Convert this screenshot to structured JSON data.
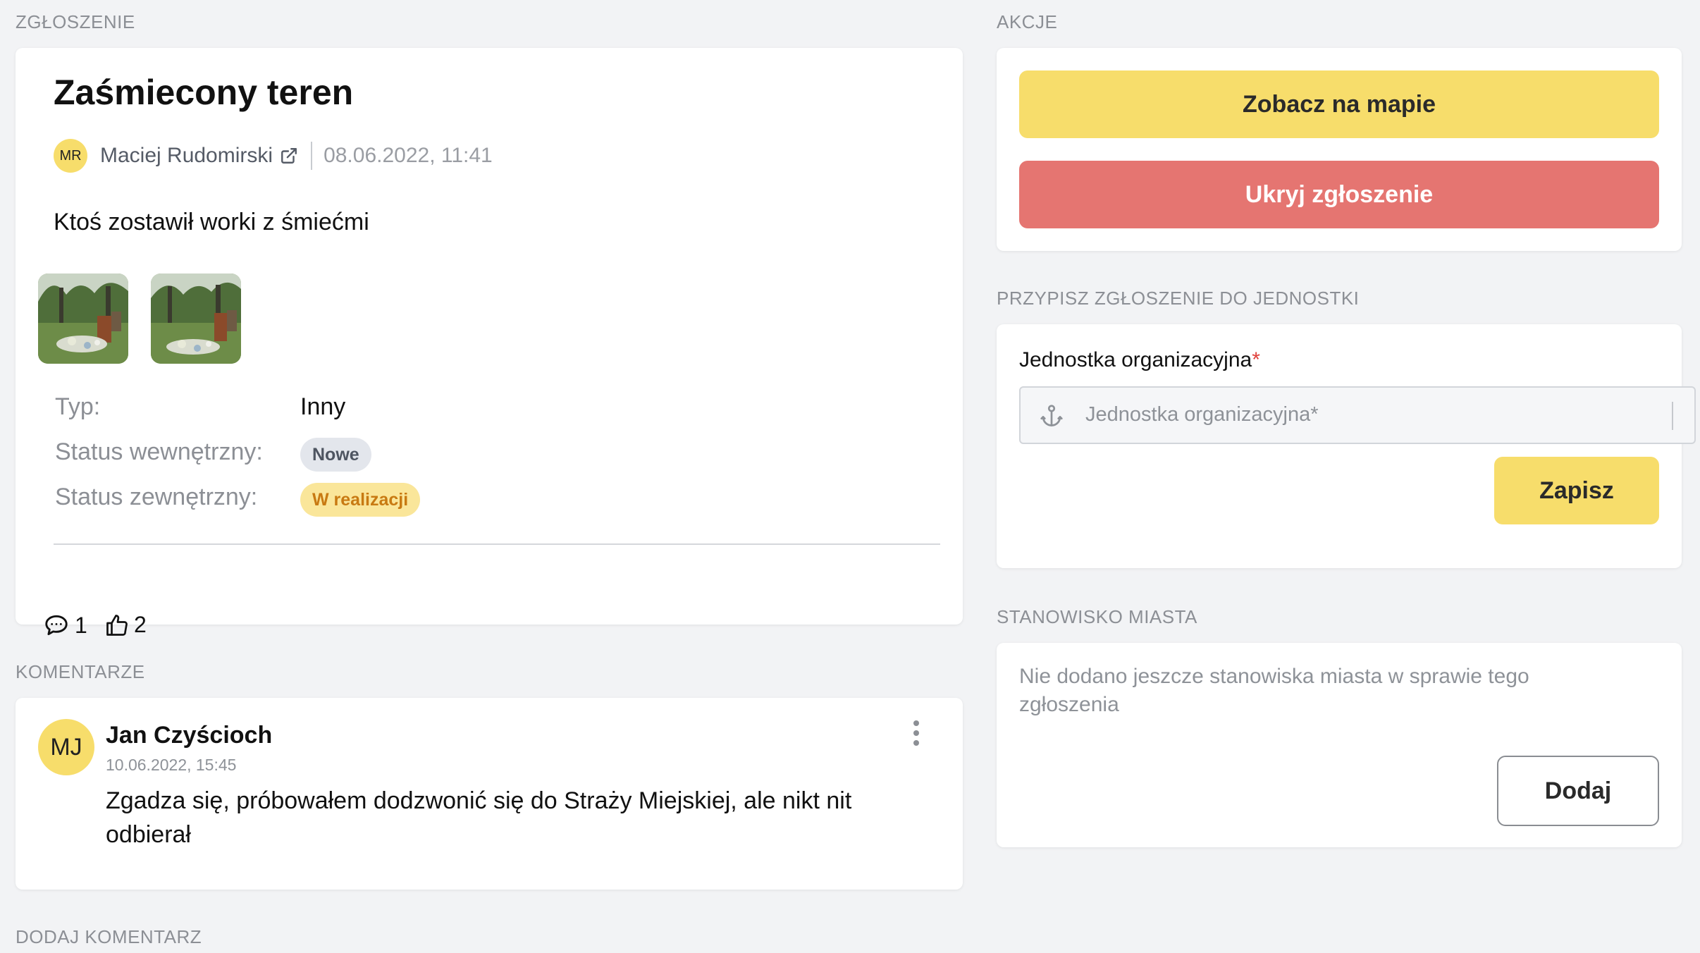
{
  "report": {
    "section_label": "ZGŁOSZENIE",
    "title": "Zaśmiecony teren",
    "author_initials": "MR",
    "author_name": "Maciej Rudomirski",
    "date": "08.06.2022, 11:41",
    "description": "Ktoś zostawił worki z śmiećmi",
    "type_label": "Typ:",
    "type_value": "Inny",
    "internal_status_label": "Status wewnętrzny:",
    "internal_status_value": "Nowe",
    "external_status_label": "Status zewnętrzny:",
    "external_status_value": "W realizacji",
    "comments_count": "1",
    "likes_count": "2"
  },
  "actions": {
    "section_label": "AKCJE",
    "map_button": "Zobacz na mapie",
    "hide_button": "Ukryj zgłoszenie"
  },
  "assign": {
    "section_label": "PRZYPISZ ZGŁOSZENIE DO JEDNOSTKI",
    "field_label": "Jednostka organizacyjna",
    "required_mark": "*",
    "placeholder": "Jednostka organizacyjna*",
    "save_button": "Zapisz"
  },
  "city_position": {
    "section_label": "STANOWISKO MIASTA",
    "empty_text": "Nie dodano jeszcze stanowiska miasta w sprawie tego zgłoszenia",
    "add_button": "Dodaj"
  },
  "comments": {
    "section_label": "KOMENTARZE",
    "items": [
      {
        "initials": "MJ",
        "author": "Jan Czyścioch",
        "date": "10.06.2022, 15:45",
        "text": "Zgadza się, próbowałem dodzwonić się do Straży Miejskiej, ale nikt nit odbierał"
      }
    ]
  },
  "add_comment": {
    "section_label": "DODAJ KOMENTARZ"
  },
  "colors": {
    "accent_yellow": "#f7dd6b",
    "danger_red": "#e57571",
    "background": "#f2f3f5"
  }
}
